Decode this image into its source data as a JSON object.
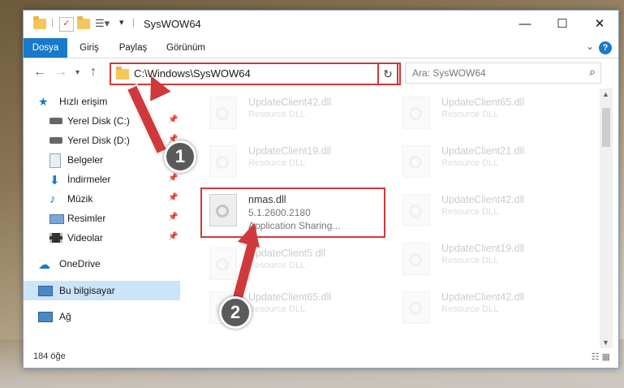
{
  "window": {
    "title": "SysWOW64"
  },
  "ribbon": {
    "tabs": [
      "Dosya",
      "Giriş",
      "Paylaş",
      "Görünüm"
    ]
  },
  "address": {
    "path": "C:\\Windows\\SysWOW64"
  },
  "search": {
    "placeholder": "Ara: SysWOW64"
  },
  "sidebar": {
    "items": [
      {
        "label": "Hızlı erişim"
      },
      {
        "label": "Yerel Disk (C:)"
      },
      {
        "label": "Yerel Disk (D:)"
      },
      {
        "label": "Belgeler"
      },
      {
        "label": "İndirmeler"
      },
      {
        "label": "Müzik"
      },
      {
        "label": "Resimler"
      },
      {
        "label": "Videolar"
      },
      {
        "label": "OneDrive"
      },
      {
        "label": "Bu bilgisayar"
      },
      {
        "label": "Ağ"
      }
    ]
  },
  "files": {
    "left": [
      {
        "name": "UpdateClient42.dll",
        "desc": "Resource DLL"
      },
      {
        "name": "UpdateClient19.dll",
        "desc": "Resource DLL"
      },
      {
        "name": "nmas.dll",
        "version": "5.1.2600.2180",
        "desc": "Application Sharing..."
      },
      {
        "name": "UpdateClient5.dll",
        "desc": "Resource DLL"
      },
      {
        "name": "UpdateClient65.dll",
        "desc": "Resource DLL"
      }
    ],
    "right": [
      {
        "name": "UpdateClient65.dll",
        "desc": "Resource DLL"
      },
      {
        "name": "UpdateClient21.dll",
        "desc": "Resource DLL"
      },
      {
        "name": "UpdateClient42.dll",
        "desc": "Resource DLL"
      },
      {
        "name": "UpdateClient19.dll",
        "desc": "Resource DLL"
      },
      {
        "name": "UpdateClient42.dll",
        "desc": "Resource DLL"
      }
    ]
  },
  "status": {
    "count": "184 öğe"
  },
  "callouts": [
    "1",
    "2"
  ],
  "colors": {
    "accent": "#1979ca",
    "highlight": "#d0393b"
  }
}
